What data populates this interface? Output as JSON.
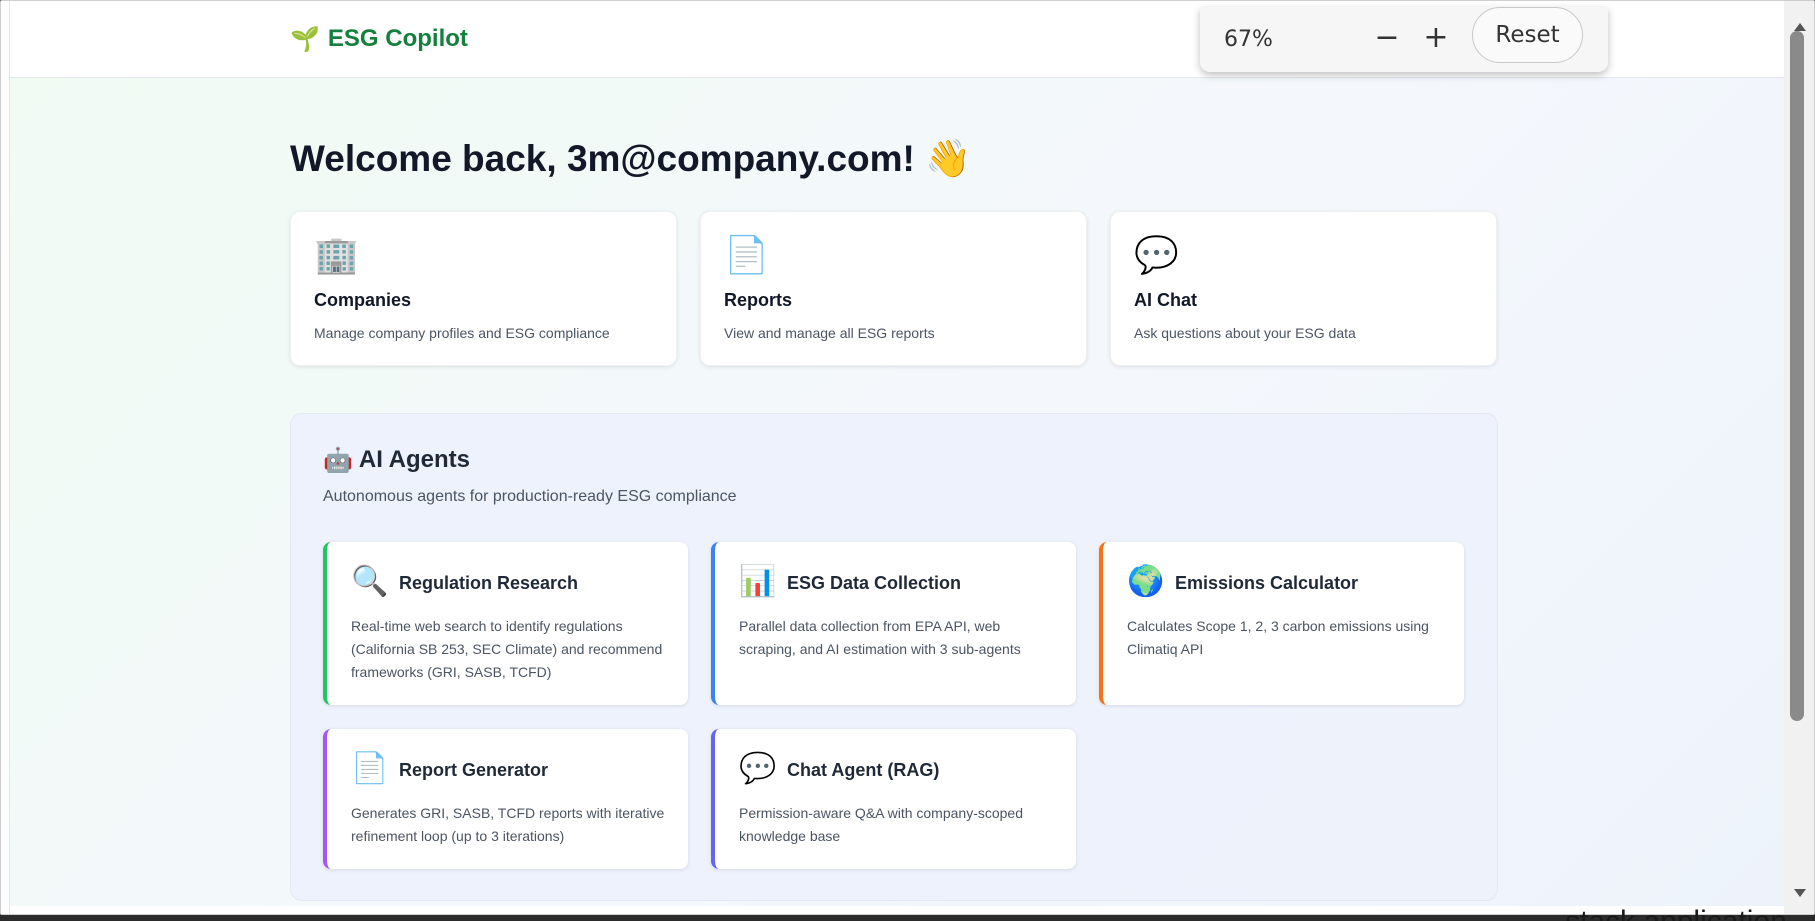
{
  "app": {
    "brand_icon": "🌱",
    "brand_name": "ESG Copilot",
    "brand_color": "#15803d"
  },
  "zoom": {
    "level": "67%",
    "minus_label": "−",
    "plus_label": "+",
    "reset_label": "Reset"
  },
  "welcome": {
    "text": "Welcome back, 3m@company.com!",
    "emoji": "👋"
  },
  "quick_links": [
    {
      "icon": "🏢",
      "icon_name": "building-icon",
      "title": "Companies",
      "description": "Manage company profiles and ESG compliance"
    },
    {
      "icon": "📄",
      "icon_name": "document-icon",
      "title": "Reports",
      "description": "View and manage all ESG reports"
    },
    {
      "icon": "💬",
      "icon_name": "chat-bubble-icon",
      "title": "AI Chat",
      "description": "Ask questions about your ESG data"
    }
  ],
  "agents": {
    "icon": "🤖",
    "title": "AI Agents",
    "subtitle": "Autonomous agents for production-ready ESG compliance",
    "items": [
      {
        "icon": "🔍",
        "icon_name": "magnifier-icon",
        "title": "Regulation Research",
        "description": "Real-time web search to identify regulations (California SB 253, SEC Climate) and recommend frameworks (GRI, SASB, TCFD)",
        "accent": "#22c55e"
      },
      {
        "icon": "📊",
        "icon_name": "bar-chart-icon",
        "title": "ESG Data Collection",
        "description": "Parallel data collection from EPA API, web scraping, and AI estimation with 3 sub-agents",
        "accent": "#3b82f6"
      },
      {
        "icon": "🌍",
        "icon_name": "globe-icon",
        "title": "Emissions Calculator",
        "description": "Calculates Scope 1, 2, 3 carbon emissions using Climatiq API",
        "accent": "#f97316"
      },
      {
        "icon": "📄",
        "icon_name": "document-icon",
        "title": "Report Generator",
        "description": "Generates GRI, SASB, TCFD reports with iterative refinement loop (up to 3 iterations)",
        "accent": "#a855f7"
      },
      {
        "icon": "💬",
        "icon_name": "chat-bubble-icon",
        "title": "Chat Agent (RAG)",
        "description": "Permission-aware Q&A with company-scoped knowledge base",
        "accent": "#6366f1"
      }
    ]
  },
  "background_window_text": "stack application"
}
